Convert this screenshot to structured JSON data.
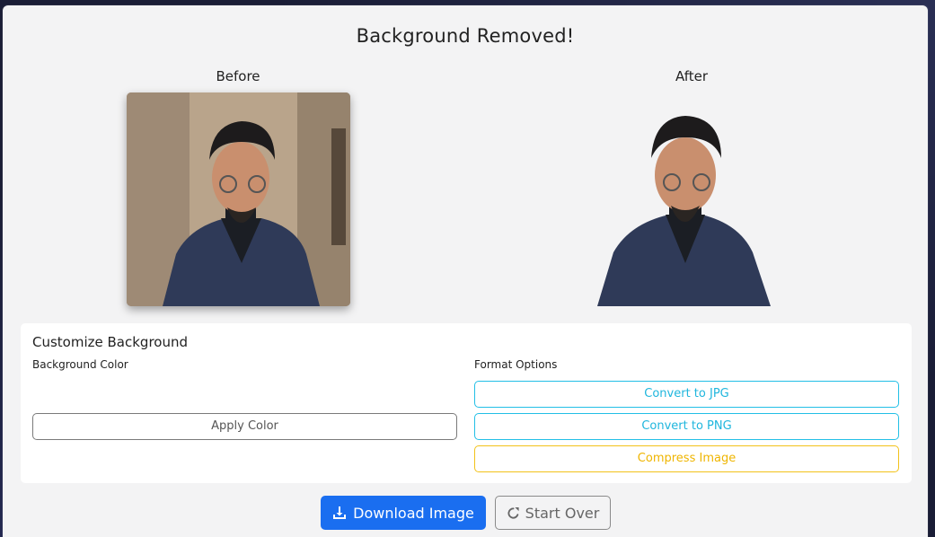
{
  "header": {
    "title": "Background Removed!"
  },
  "preview": {
    "before_label": "Before",
    "after_label": "After"
  },
  "customize": {
    "title": "Customize Background",
    "background_color_label": "Background Color",
    "apply_color_label": "Apply Color",
    "format_options_label": "Format Options",
    "convert_jpg_label": "Convert to JPG",
    "convert_png_label": "Convert to PNG",
    "compress_label": "Compress Image"
  },
  "actions": {
    "download_label": "Download Image",
    "start_over_label": "Start Over"
  },
  "icons": {
    "download": "download-icon",
    "start_over": "redo-icon"
  },
  "colors": {
    "primary": "#1a6ef0",
    "info": "#1fb6dd",
    "warning": "#efb500"
  }
}
